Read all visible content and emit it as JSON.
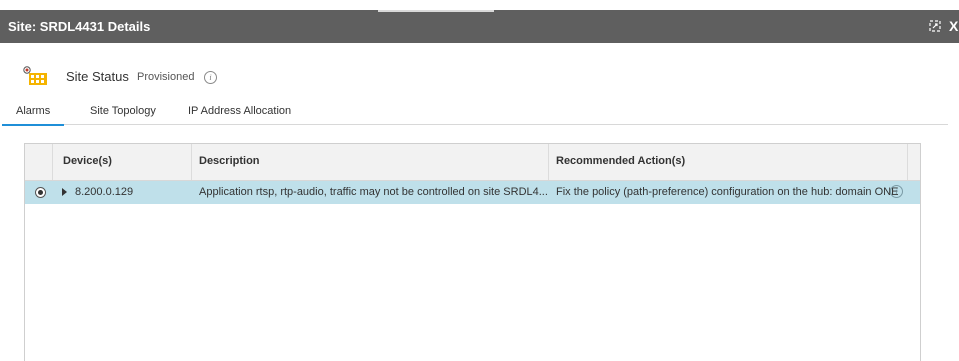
{
  "window": {
    "title": "Site: SRDL4431 Details",
    "close_glyph": "X"
  },
  "site_status": {
    "label": "Site Status",
    "value": "Provisioned",
    "icon": "site-building-icon",
    "info_glyph": "i"
  },
  "tabs": [
    {
      "label": "Alarms",
      "active": true
    },
    {
      "label": "Site Topology",
      "active": false
    },
    {
      "label": "IP Address Allocation",
      "active": false
    }
  ],
  "table": {
    "columns": [
      "Device(s)",
      "Description",
      "Recommended Action(s)"
    ],
    "rows": [
      {
        "selected": true,
        "device": "8.200.0.129",
        "description": "Application rtsp, rtp-audio, traffic may not be controlled on site SRDL4...",
        "action": "Fix the policy (path-preference) configuration on the hub: domain ONE"
      }
    ]
  },
  "colors": {
    "titlebar": "#5f5f5f",
    "active_tab": "#1f8fd8",
    "selected_row": "#bfe0ea",
    "site_icon": "#f5b400"
  }
}
